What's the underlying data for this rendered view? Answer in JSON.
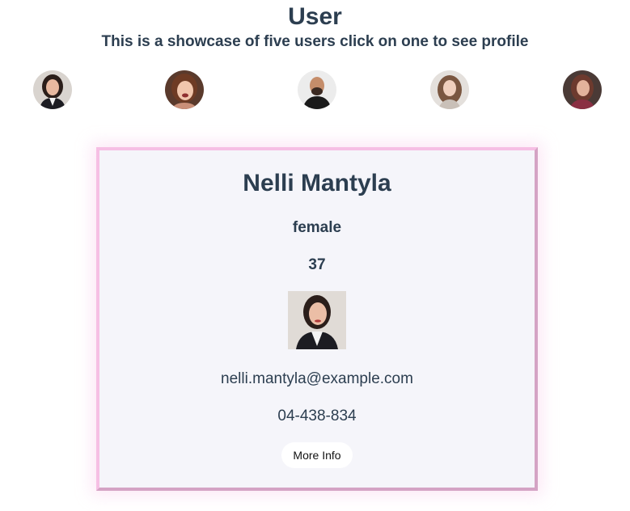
{
  "header": {
    "title": "User",
    "subtitle": "This is a showcase of five users click on one to see profile"
  },
  "users": [
    {
      "avatar_label": "Nelli Mantyla avatar",
      "icon": "woman-dark-hair-avatar"
    },
    {
      "avatar_label": "User 2 avatar",
      "icon": "woman-auburn-hair-avatar"
    },
    {
      "avatar_label": "User 3 avatar",
      "icon": "bald-man-avatar"
    },
    {
      "avatar_label": "User 4 avatar",
      "icon": "woman-curly-hair-avatar"
    },
    {
      "avatar_label": "User 5 avatar",
      "icon": "woman-brown-hair-avatar"
    }
  ],
  "profile": {
    "name": "Nelli Mantyla",
    "gender": "female",
    "age": "37",
    "email": "nelli.mantyla@example.com",
    "phone": "04-438-834",
    "more_label": "More Info"
  },
  "colors": {
    "text": "#2c3e50",
    "card_background": "#f5f5fa",
    "card_border_light": "#f6bfe4",
    "card_border_dark": "#d4a3c4"
  }
}
